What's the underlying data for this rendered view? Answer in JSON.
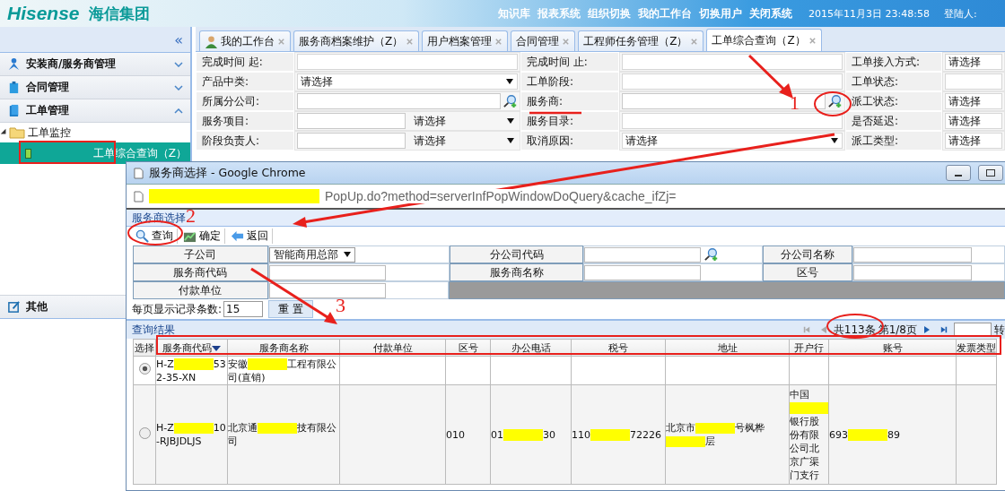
{
  "header": {
    "logo": "Hisense",
    "brand": "海信集团",
    "nav": [
      "知识库",
      "报表系统",
      "组织切换",
      "我的工作台",
      "切换用户",
      "关闭系统"
    ],
    "datetime": "2015年11月3日 23:48:58",
    "user_label": "登陆人:"
  },
  "sidebar": {
    "collapse": "«",
    "sections": [
      {
        "label": "安装商/服务商管理",
        "expanded": false
      },
      {
        "label": "合同管理",
        "expanded": false
      },
      {
        "label": "工单管理",
        "expanded": true,
        "children": [
          {
            "label": "工单监控",
            "expanded": true,
            "children": [
              {
                "label": "工单综合查询（Z）",
                "selected": true
              }
            ]
          }
        ]
      }
    ],
    "bottom": {
      "label": "其他"
    }
  },
  "tabs": [
    {
      "label": "我的工作台",
      "selected": false
    },
    {
      "label": "服务商档案维护（Z）",
      "selected": false
    },
    {
      "label": "用户档案管理",
      "selected": false
    },
    {
      "label": "合同管理",
      "selected": false
    },
    {
      "label": "工程师任务管理（Z）",
      "selected": false
    },
    {
      "label": "工单综合查询（Z）",
      "selected": true
    }
  ],
  "form": {
    "rows": [
      [
        {
          "label": "完成时间 起:",
          "kind": "empty"
        },
        {
          "label": "完成时间 止:",
          "kind": "empty"
        },
        {
          "label": "工单接入方式:",
          "kind": "value",
          "value": "请选择"
        }
      ],
      [
        {
          "label": "产品中类:",
          "kind": "select",
          "value": "请选择"
        },
        {
          "label": "工单阶段:",
          "kind": "empty"
        },
        {
          "label": "工单状态:",
          "kind": "empty"
        }
      ],
      [
        {
          "label": "所属分公司:",
          "kind": "lookup"
        },
        {
          "label": "服务商:",
          "kind": "lookup"
        },
        {
          "label": "派工状态:",
          "kind": "value",
          "value": "请选择"
        }
      ],
      [
        {
          "label": "服务项目:",
          "kind": "combo",
          "value": "请选择"
        },
        {
          "label": "服务目录:",
          "kind": "empty"
        },
        {
          "label": "是否延迟:",
          "kind": "value",
          "value": "请选择"
        }
      ],
      [
        {
          "label": "阶段负责人:",
          "kind": "combo",
          "value": "请选择"
        },
        {
          "label": "取消原因:",
          "kind": "select",
          "value": "请选择"
        },
        {
          "label": "派工类型:",
          "kind": "value",
          "value": "请选择"
        }
      ]
    ]
  },
  "popup": {
    "title": "服务商选择 - Google Chrome",
    "address": "PopUp.do?method=serverInfPopWindowDoQuery&cache_ifZj=",
    "heading": "服务商选择",
    "toolbar": [
      "查询",
      "确定",
      "返回"
    ],
    "query_rows": [
      [
        {
          "label": "子公司",
          "kind": "dropdown",
          "value": "智能商用总部"
        },
        {
          "label": "分公司代码",
          "kind": "lookup"
        },
        {
          "label": "分公司名称",
          "kind": "empty"
        }
      ],
      [
        {
          "label": "服务商代码",
          "kind": "empty"
        },
        {
          "label": "服务商名称",
          "kind": "empty"
        },
        {
          "label": "区号",
          "kind": "empty"
        }
      ],
      [
        {
          "label": "付款单位",
          "kind": "empty"
        }
      ]
    ],
    "page_size_label": "每页显示记录条数:",
    "page_size": "15",
    "reset": "重 置",
    "results_title": "查询结果",
    "total": "共113条",
    "page": "第1/8页",
    "goto": "转",
    "columns": [
      "选择",
      "服务商代码",
      "服务商名称",
      "付款单位",
      "区号",
      "办公电话",
      "税号",
      "地址",
      "开户行",
      "账号",
      "发票类型"
    ],
    "rows": [
      {
        "selected": true,
        "cells": [
          [],
          [
            "H-Z",
            "532-35-XN"
          ],
          [
            "安徽",
            "工程有限公司(直销)"
          ],
          [],
          [],
          [],
          [],
          [],
          [],
          [],
          []
        ]
      },
      {
        "selected": false,
        "cells": [
          [],
          [
            "H-Z",
            "10-RJBJDLJS"
          ],
          [
            "北京通",
            "技有限公司"
          ],
          [],
          [
            "010"
          ],
          [
            "01",
            "30"
          ],
          [
            "110",
            "72226"
          ],
          [
            "北京市",
            "号枫桦",
            "层"
          ],
          [
            "中国",
            "银行股份有限公司北京广渠门支行"
          ],
          [
            "693",
            "89"
          ],
          []
        ]
      }
    ]
  },
  "annotations": {
    "labels": [
      "1",
      "2",
      "3"
    ]
  }
}
